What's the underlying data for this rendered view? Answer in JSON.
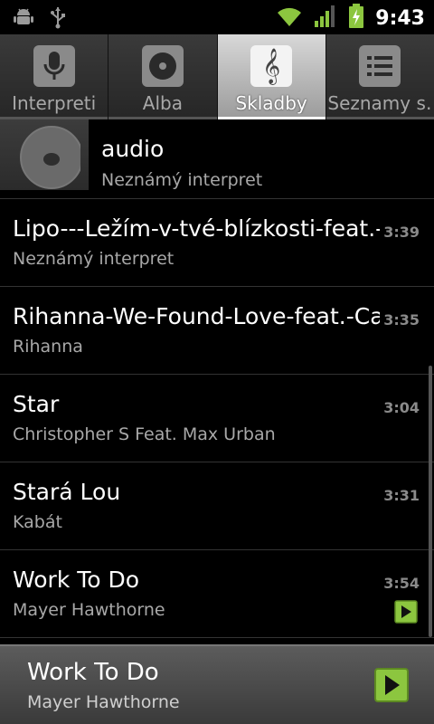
{
  "status_bar": {
    "time": "9:43",
    "icons": [
      "android-debug-icon",
      "usb-icon",
      "wifi-icon",
      "signal-icon",
      "battery-charging-icon"
    ]
  },
  "tabs": [
    {
      "label": "Interpreti",
      "icon": "microphone-icon",
      "active": false
    },
    {
      "label": "Alba",
      "icon": "album-icon",
      "active": false
    },
    {
      "label": "Skladby",
      "icon": "music-note-icon",
      "active": true
    },
    {
      "label": "Seznamy s…",
      "icon": "playlist-icon",
      "active": false
    }
  ],
  "album_header": {
    "title": "audio",
    "artist": "Neznámý interpret"
  },
  "songs": [
    {
      "title": "Lipo---Ležím-v-tvé-blízkosti-feat.-Dj",
      "artist": "Neznámý interpret",
      "duration": "3:39"
    },
    {
      "title": "Rihanna-We-Found-Love-feat.-Calvin",
      "artist": "Rihanna",
      "duration": "3:35"
    },
    {
      "title": "Star",
      "artist": "Christopher S Feat. Max Urban",
      "duration": "3:04"
    },
    {
      "title": "Stará Lou",
      "artist": "Kabát",
      "duration": "3:31"
    },
    {
      "title": "Work To Do",
      "artist": "Mayer Hawthorne",
      "duration": "3:54"
    }
  ],
  "now_playing": {
    "title": "Work To Do",
    "artist": "Mayer Hawthorne"
  },
  "colors": {
    "accent_green": "#8cc63f",
    "background": "#000000"
  }
}
